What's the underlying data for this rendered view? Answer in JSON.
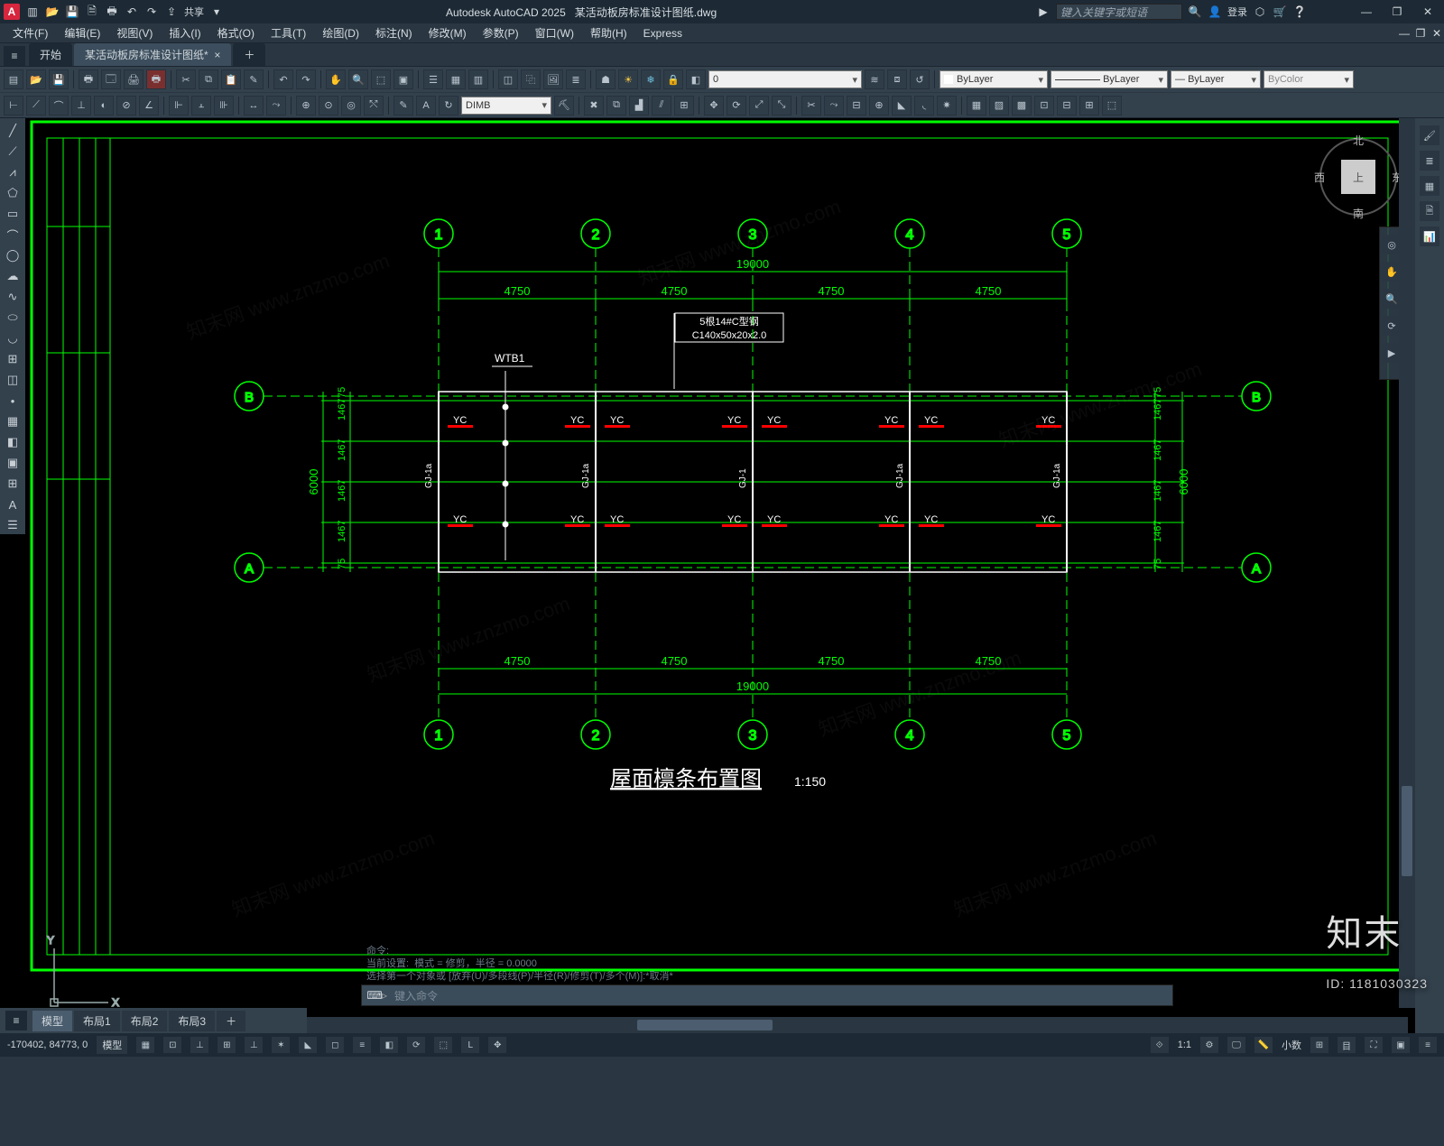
{
  "app": {
    "title_prefix": "Autodesk AutoCAD 2025",
    "doc": "某活动板房标准设计图纸.dwg"
  },
  "search": {
    "placeholder": "键入关键字或短语"
  },
  "account": {
    "login": "登录"
  },
  "titlebar_quick": [
    "new",
    "open",
    "save",
    "saveas",
    "plot",
    "undo",
    "redo",
    "share"
  ],
  "share_label": "共享",
  "menubar": [
    "文件(F)",
    "编辑(E)",
    "视图(V)",
    "插入(I)",
    "格式(O)",
    "工具(T)",
    "绘图(D)",
    "标注(N)",
    "修改(M)",
    "参数(P)",
    "窗口(W)",
    "帮助(H)",
    "Express"
  ],
  "tabs": {
    "start": "开始",
    "file": "某活动板房标准设计图纸*"
  },
  "ribbon": {
    "layer_value": "0",
    "props": {
      "layer": "ByLayer",
      "ltype": "ByLayer",
      "lweight": "ByLayer",
      "color": "ByColor"
    },
    "dimstyle": "DIMB"
  },
  "viewcube": {
    "top": "上",
    "n": "北",
    "s": "南",
    "e": "东",
    "w": "西"
  },
  "drawing": {
    "grid_cols": [
      "1",
      "2",
      "3",
      "4",
      "5"
    ],
    "grid_rows": [
      "A",
      "B"
    ],
    "col_spacing": "4750",
    "total_width": "19000",
    "row_heights": [
      "75",
      "1467",
      "1467",
      "1467",
      "1467",
      "75"
    ],
    "total_height": "6000",
    "note_line1": "5根14#C型钢",
    "note_line2": "C140x50x20x2.0",
    "wtb": "WTB1",
    "yc": "YC",
    "gj": "GJ-1a",
    "gj2": "GJ-1",
    "title": "屋面檩条布置图",
    "scale": "1:150"
  },
  "cmd": {
    "hist": "命令:\n当前设置:  模式 = 修剪，半径 = 0.0000\n选择第一个对象或 [放弃(U)/多段线(P)/半径(R)/修剪(T)/多个(M)]:*取消*",
    "placeholder": "键入命令"
  },
  "bottom_tabs": [
    "模型",
    "布局1",
    "布局2",
    "布局3"
  ],
  "status": {
    "coords": "-170402, 84773, 0",
    "paper": "模型",
    "scale": "1:1",
    "annoscale": "小数",
    "items": [
      "grid",
      "snap",
      "ortho",
      "polar",
      "osnap",
      "otrack",
      "dyn",
      "lwt",
      "trans",
      "cycle",
      "3dosnap",
      "ducs",
      "gizmo",
      "anno",
      "ws",
      "units",
      "qprops",
      "iso",
      "hw",
      "clean"
    ]
  },
  "brand": {
    "name": "知末",
    "id": "ID: 1181030323"
  }
}
